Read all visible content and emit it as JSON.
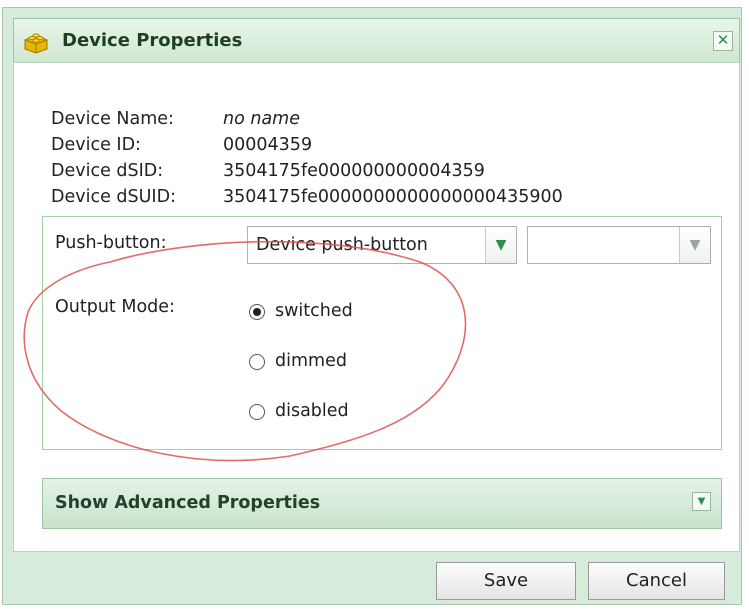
{
  "dialog": {
    "title": "Device Properties",
    "close_glyph": "✕",
    "title_icon": "lego-brick-icon"
  },
  "info": [
    {
      "label": "Device Name:",
      "value": "no name",
      "italic": true
    },
    {
      "label": "Device ID:",
      "value": "00004359"
    },
    {
      "label": "Device dSID:",
      "value": "3504175fe000000000004359"
    },
    {
      "label": "Device dSUID:",
      "value": "3504175fe0000000000000000435900"
    }
  ],
  "push_button": {
    "label": "Push-button:",
    "select_value": "Device push-button",
    "second_select_value": ""
  },
  "output_mode": {
    "label": "Output Mode:",
    "options": [
      {
        "label": "switched",
        "checked": true
      },
      {
        "label": "dimmed",
        "checked": false
      },
      {
        "label": "disabled",
        "checked": false
      }
    ]
  },
  "advanced": {
    "label": "Show Advanced Properties"
  },
  "buttons": {
    "save": "Save",
    "cancel": "Cancel"
  },
  "colors": {
    "accent_green": "#2c8e48",
    "panel_bg": "#d6ebd9",
    "annotation": "#e05050"
  }
}
